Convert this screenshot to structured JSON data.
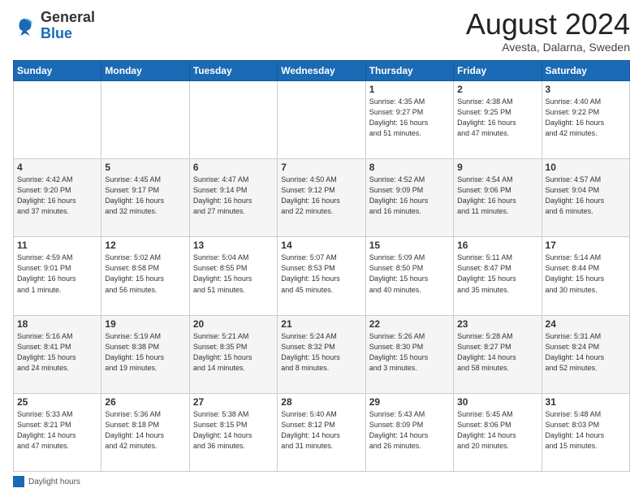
{
  "header": {
    "logo_general": "General",
    "logo_blue": "Blue",
    "month_year": "August 2024",
    "location": "Avesta, Dalarna, Sweden"
  },
  "days_of_week": [
    "Sunday",
    "Monday",
    "Tuesday",
    "Wednesday",
    "Thursday",
    "Friday",
    "Saturday"
  ],
  "weeks": [
    [
      {
        "num": "",
        "info": ""
      },
      {
        "num": "",
        "info": ""
      },
      {
        "num": "",
        "info": ""
      },
      {
        "num": "",
        "info": ""
      },
      {
        "num": "1",
        "info": "Sunrise: 4:35 AM\nSunset: 9:27 PM\nDaylight: 16 hours\nand 51 minutes."
      },
      {
        "num": "2",
        "info": "Sunrise: 4:38 AM\nSunset: 9:25 PM\nDaylight: 16 hours\nand 47 minutes."
      },
      {
        "num": "3",
        "info": "Sunrise: 4:40 AM\nSunset: 9:22 PM\nDaylight: 16 hours\nand 42 minutes."
      }
    ],
    [
      {
        "num": "4",
        "info": "Sunrise: 4:42 AM\nSunset: 9:20 PM\nDaylight: 16 hours\nand 37 minutes."
      },
      {
        "num": "5",
        "info": "Sunrise: 4:45 AM\nSunset: 9:17 PM\nDaylight: 16 hours\nand 32 minutes."
      },
      {
        "num": "6",
        "info": "Sunrise: 4:47 AM\nSunset: 9:14 PM\nDaylight: 16 hours\nand 27 minutes."
      },
      {
        "num": "7",
        "info": "Sunrise: 4:50 AM\nSunset: 9:12 PM\nDaylight: 16 hours\nand 22 minutes."
      },
      {
        "num": "8",
        "info": "Sunrise: 4:52 AM\nSunset: 9:09 PM\nDaylight: 16 hours\nand 16 minutes."
      },
      {
        "num": "9",
        "info": "Sunrise: 4:54 AM\nSunset: 9:06 PM\nDaylight: 16 hours\nand 11 minutes."
      },
      {
        "num": "10",
        "info": "Sunrise: 4:57 AM\nSunset: 9:04 PM\nDaylight: 16 hours\nand 6 minutes."
      }
    ],
    [
      {
        "num": "11",
        "info": "Sunrise: 4:59 AM\nSunset: 9:01 PM\nDaylight: 16 hours\nand 1 minute."
      },
      {
        "num": "12",
        "info": "Sunrise: 5:02 AM\nSunset: 8:58 PM\nDaylight: 15 hours\nand 56 minutes."
      },
      {
        "num": "13",
        "info": "Sunrise: 5:04 AM\nSunset: 8:55 PM\nDaylight: 15 hours\nand 51 minutes."
      },
      {
        "num": "14",
        "info": "Sunrise: 5:07 AM\nSunset: 8:53 PM\nDaylight: 15 hours\nand 45 minutes."
      },
      {
        "num": "15",
        "info": "Sunrise: 5:09 AM\nSunset: 8:50 PM\nDaylight: 15 hours\nand 40 minutes."
      },
      {
        "num": "16",
        "info": "Sunrise: 5:11 AM\nSunset: 8:47 PM\nDaylight: 15 hours\nand 35 minutes."
      },
      {
        "num": "17",
        "info": "Sunrise: 5:14 AM\nSunset: 8:44 PM\nDaylight: 15 hours\nand 30 minutes."
      }
    ],
    [
      {
        "num": "18",
        "info": "Sunrise: 5:16 AM\nSunset: 8:41 PM\nDaylight: 15 hours\nand 24 minutes."
      },
      {
        "num": "19",
        "info": "Sunrise: 5:19 AM\nSunset: 8:38 PM\nDaylight: 15 hours\nand 19 minutes."
      },
      {
        "num": "20",
        "info": "Sunrise: 5:21 AM\nSunset: 8:35 PM\nDaylight: 15 hours\nand 14 minutes."
      },
      {
        "num": "21",
        "info": "Sunrise: 5:24 AM\nSunset: 8:32 PM\nDaylight: 15 hours\nand 8 minutes."
      },
      {
        "num": "22",
        "info": "Sunrise: 5:26 AM\nSunset: 8:30 PM\nDaylight: 15 hours\nand 3 minutes."
      },
      {
        "num": "23",
        "info": "Sunrise: 5:28 AM\nSunset: 8:27 PM\nDaylight: 14 hours\nand 58 minutes."
      },
      {
        "num": "24",
        "info": "Sunrise: 5:31 AM\nSunset: 8:24 PM\nDaylight: 14 hours\nand 52 minutes."
      }
    ],
    [
      {
        "num": "25",
        "info": "Sunrise: 5:33 AM\nSunset: 8:21 PM\nDaylight: 14 hours\nand 47 minutes."
      },
      {
        "num": "26",
        "info": "Sunrise: 5:36 AM\nSunset: 8:18 PM\nDaylight: 14 hours\nand 42 minutes."
      },
      {
        "num": "27",
        "info": "Sunrise: 5:38 AM\nSunset: 8:15 PM\nDaylight: 14 hours\nand 36 minutes."
      },
      {
        "num": "28",
        "info": "Sunrise: 5:40 AM\nSunset: 8:12 PM\nDaylight: 14 hours\nand 31 minutes."
      },
      {
        "num": "29",
        "info": "Sunrise: 5:43 AM\nSunset: 8:09 PM\nDaylight: 14 hours\nand 26 minutes."
      },
      {
        "num": "30",
        "info": "Sunrise: 5:45 AM\nSunset: 8:06 PM\nDaylight: 14 hours\nand 20 minutes."
      },
      {
        "num": "31",
        "info": "Sunrise: 5:48 AM\nSunset: 8:03 PM\nDaylight: 14 hours\nand 15 minutes."
      }
    ]
  ],
  "footer": {
    "daylight_label": "Daylight hours"
  }
}
